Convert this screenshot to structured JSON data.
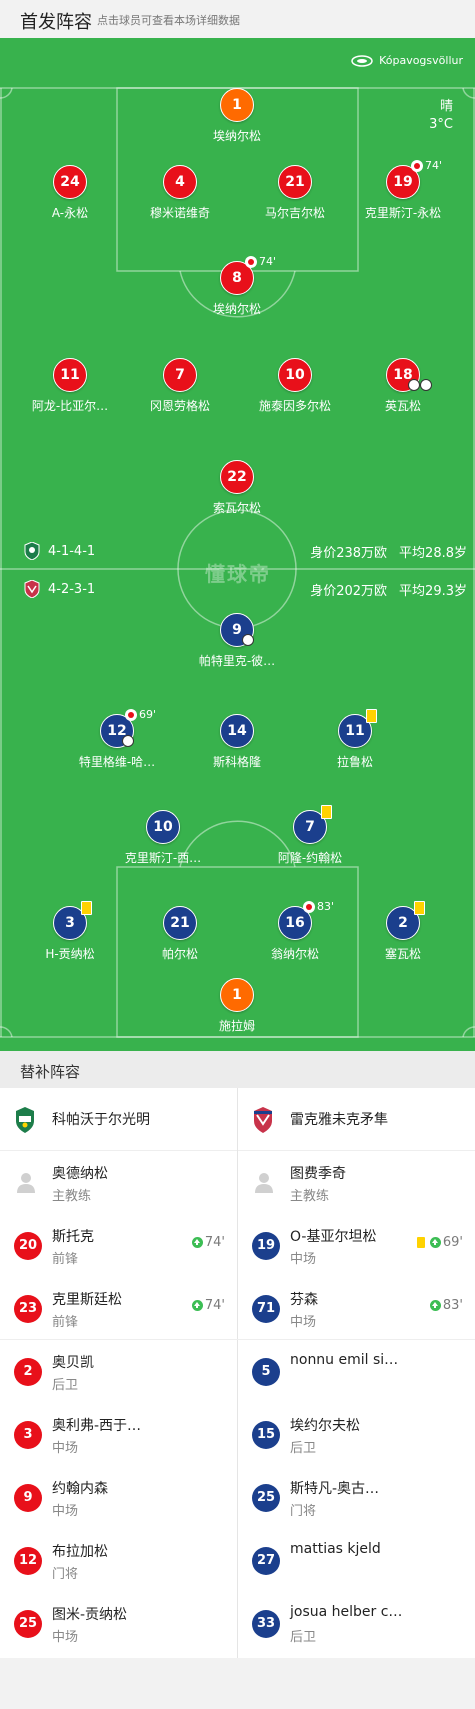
{
  "header": {
    "title": "首发阵容",
    "hint": "点击球员可查看本场详细数据"
  },
  "venue": {
    "name": "Kópavogsvöllur",
    "icon": "stadium-icon"
  },
  "weather": {
    "condition": "晴",
    "temperature": "3°C"
  },
  "watermark": "懂球帝",
  "home": {
    "formation": "4-1-4-1",
    "value": "身价238万欧",
    "avg_age": "平均28.8岁",
    "color": "#e8101a",
    "players": [
      {
        "num": "1",
        "name": "埃纳尔松",
        "keeper": true
      },
      {
        "num": "24",
        "name": "A-永松"
      },
      {
        "num": "4",
        "name": "穆米诺维奇"
      },
      {
        "num": "21",
        "name": "马尔吉尔松"
      },
      {
        "num": "19",
        "name": "克里斯汀-永松",
        "sub_out": "74'"
      },
      {
        "num": "8",
        "name": "埃纳尔松",
        "sub_out": "74'"
      },
      {
        "num": "11",
        "name": "阿龙-比亚尔…"
      },
      {
        "num": "7",
        "name": "冈恩劳格松"
      },
      {
        "num": "10",
        "name": "施泰因多尔松"
      },
      {
        "num": "18",
        "name": "英瓦松",
        "goals": 2
      },
      {
        "num": "22",
        "name": "索瓦尔松"
      }
    ]
  },
  "away": {
    "formation": "4-2-3-1",
    "value": "身价202万欧",
    "avg_age": "平均29.3岁",
    "color": "#1b3f8d",
    "players": [
      {
        "num": "9",
        "name": "帕特里克-彼…",
        "goals": 1
      },
      {
        "num": "12",
        "name": "特里格维-哈…",
        "sub_out": "69'",
        "goals": 1
      },
      {
        "num": "14",
        "name": "斯科格隆"
      },
      {
        "num": "11",
        "name": "拉鲁松",
        "yellow": true
      },
      {
        "num": "10",
        "name": "克里斯汀-西…"
      },
      {
        "num": "7",
        "name": "阿隆-约翰松",
        "yellow": true
      },
      {
        "num": "3",
        "name": "H-贡纳松",
        "yellow": true
      },
      {
        "num": "21",
        "name": "帕尔松"
      },
      {
        "num": "16",
        "name": "翁纳尔松",
        "sub_out": "83'"
      },
      {
        "num": "2",
        "name": "塞瓦松",
        "yellow": true
      },
      {
        "num": "1",
        "name": "施拉姆",
        "keeper": true
      }
    ]
  },
  "subs": {
    "title": "替补阵容",
    "home_team": "科帕沃于尔光明",
    "away_team": "雷克雅未克矛隼",
    "home_coach": {
      "name": "奥德纳松",
      "role": "主教练"
    },
    "away_coach": {
      "name": "图费季奇",
      "role": "主教练"
    },
    "home_list": [
      {
        "num": "20",
        "name": "斯托克",
        "pos": "前锋",
        "sub_in": "74'"
      },
      {
        "num": "23",
        "name": "克里斯廷松",
        "pos": "前锋",
        "sub_in": "74'"
      },
      {
        "num": "2",
        "name": "奥贝凯",
        "pos": "后卫"
      },
      {
        "num": "3",
        "name": "奥利弗-西于…",
        "pos": "中场"
      },
      {
        "num": "9",
        "name": "约翰内森",
        "pos": "中场"
      },
      {
        "num": "12",
        "name": "布拉加松",
        "pos": "门将"
      },
      {
        "num": "25",
        "name": "图米-贡纳松",
        "pos": "中场"
      }
    ],
    "away_list": [
      {
        "num": "19",
        "name": "O-基亚尔坦松",
        "pos": "中场",
        "sub_in": "69'",
        "yellow": true
      },
      {
        "num": "71",
        "name": "芬森",
        "pos": "中场",
        "sub_in": "83'"
      },
      {
        "num": "5",
        "name": "nonnu emil si…",
        "pos": ""
      },
      {
        "num": "15",
        "name": "埃约尔夫松",
        "pos": "后卫"
      },
      {
        "num": "25",
        "name": "斯特凡-奥古…",
        "pos": "门将"
      },
      {
        "num": "27",
        "name": "mattias kjeld",
        "pos": ""
      },
      {
        "num": "33",
        "name": "josua helber c…",
        "pos": "后卫"
      }
    ]
  }
}
